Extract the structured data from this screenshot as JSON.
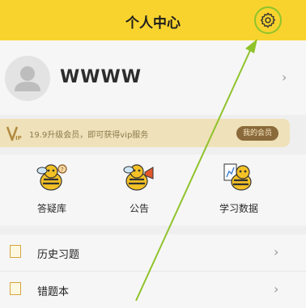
{
  "header": {
    "title": "个人中心",
    "settings_icon": "gear-icon"
  },
  "profile": {
    "username": "WWWW",
    "avatar_icon": "user-avatar-icon",
    "chevron": "›"
  },
  "vip": {
    "logo_text": "Vip",
    "text": "19.9升级会员，即可获得vip服务",
    "button": "我的会员"
  },
  "features": [
    {
      "label": "答疑库",
      "icon": "bee-qa-icon"
    },
    {
      "label": "公告",
      "icon": "bee-megaphone-icon"
    },
    {
      "label": "学习数据",
      "icon": "bee-chart-icon"
    }
  ],
  "list": [
    {
      "label": "历史习题",
      "icon": "history-icon",
      "chevron": "›"
    },
    {
      "label": "错题本",
      "icon": "mistake-book-icon",
      "chevron": "›"
    }
  ],
  "colors": {
    "header": "#f8d32e",
    "annotation": "#8fc32b",
    "vip_banner": "#efe1b9"
  }
}
